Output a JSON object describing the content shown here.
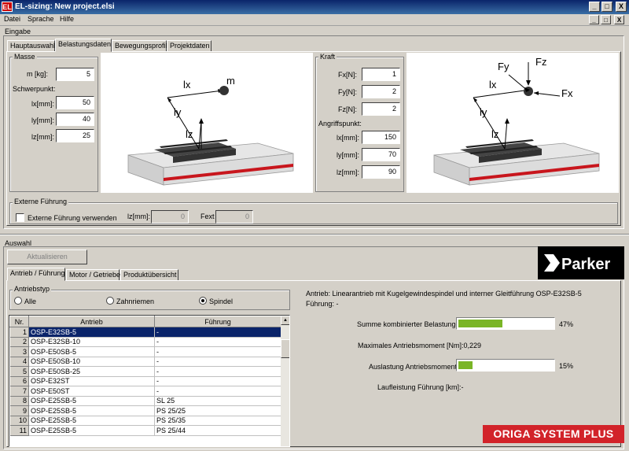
{
  "window": {
    "title": "EL-sizing: New project.elsi",
    "icon_text": "EL",
    "controls": [
      "_",
      "□",
      "X"
    ],
    "doc_controls": [
      "_",
      "□",
      "X"
    ]
  },
  "menu": [
    "Datei",
    "Sprache",
    "Hilfe"
  ],
  "eingabe": {
    "label": "Eingabe",
    "tabs": [
      "Hauptauswahl",
      "Belastungsdaten",
      "Bewegungsprofil",
      "Projektdaten"
    ],
    "masse": {
      "title": "Masse",
      "m_label": "m [kg]:",
      "m_value": "5",
      "schwerpunkt_label": "Schwerpunkt:",
      "lx_label": "lx[mm]:",
      "lx_value": "50",
      "ly_label": "ly[mm]:",
      "ly_value": "40",
      "lz_label": "lz[mm]:",
      "lz_value": "25"
    },
    "kraft": {
      "title": "Kraft",
      "fx_label": "Fx[N]:",
      "fx_value": "1",
      "fy_label": "Fy[N]:",
      "fy_value": "2",
      "fz_label": "Fz[N]:",
      "fz_value": "2",
      "angriff_label": "Angriffspunkt:",
      "lx_label": "lx[mm]:",
      "lx_value": "150",
      "ly_label": "ly[mm]:",
      "ly_value": "70",
      "lz_label": "lz[mm]:",
      "lz_value": "90"
    },
    "diagram_left": {
      "lx": "lx",
      "ly": "ly",
      "lz": "lz",
      "m": "m"
    },
    "diagram_right": {
      "lx": "lx",
      "ly": "ly",
      "lz": "lz",
      "fy": "Fy",
      "fz": "Fz",
      "fx": "Fx"
    },
    "externe": {
      "title": "Externe Führung",
      "checkbox_label": "Externe Führung verwenden",
      "lz_label": "lz[mm]:",
      "lz_value": "0",
      "fext_label": "Fext",
      "fext_value": "0"
    }
  },
  "auswahl": {
    "label": "Auswahl",
    "aktualisieren": "Aktualisieren",
    "logo": "Parker",
    "tabs": [
      "Antrieb / Führung",
      "Motor / Getriebe",
      "Produktübersicht"
    ],
    "antriebstyp": {
      "title": "Antriebstyp",
      "options": [
        "Alle",
        "Zahnriemen",
        "Spindel"
      ],
      "selected": "Spindel"
    },
    "table": {
      "columns": [
        "Nr.",
        "Antrieb",
        "Führung"
      ],
      "rows": [
        [
          "1",
          "OSP-E32SB-5",
          "-"
        ],
        [
          "2",
          "OSP-E32SB-10",
          "-"
        ],
        [
          "3",
          "OSP-E50SB-5",
          "-"
        ],
        [
          "4",
          "OSP-E50SB-10",
          "-"
        ],
        [
          "5",
          "OSP-E50SB-25",
          "-"
        ],
        [
          "6",
          "OSP-E32ST",
          "-"
        ],
        [
          "7",
          "OSP-E50ST",
          "-"
        ],
        [
          "8",
          "OSP-E25SB-5",
          "SL 25"
        ],
        [
          "9",
          "OSP-E25SB-5",
          "PS 25/25"
        ],
        [
          "10",
          "OSP-E25SB-5",
          "PS 25/35"
        ],
        [
          "11",
          "OSP-E25SB-5",
          "PS 25/44"
        ]
      ],
      "selected_row": 0
    },
    "details": {
      "antrieb_line": "Antrieb: Linearantrieb mit Kugelgewindespindel und interner Gleitführung OSP-E32SB-5",
      "fuehrung_line": "Führung: -",
      "summe_label": "Summe kombinierter Belastungen:",
      "summe_pct": "47%",
      "summe_value": 0.47,
      "moment_label": "Maximales Antriebsmoment [Nm]:0,229",
      "auslastung_label": "Auslastung Antriebsmoment:",
      "auslastung_pct": "15%",
      "auslastung_value": 0.15,
      "laufleistung_label": "Laufleistung Führung [km]:-"
    },
    "brand_banner": "ORIGA SYSTEM PLUS"
  },
  "colors": {
    "accent_bar": "#7ab526",
    "title_blue": "#0a246a",
    "banner_red": "#d2232a",
    "rail_red": "#c8161d"
  }
}
